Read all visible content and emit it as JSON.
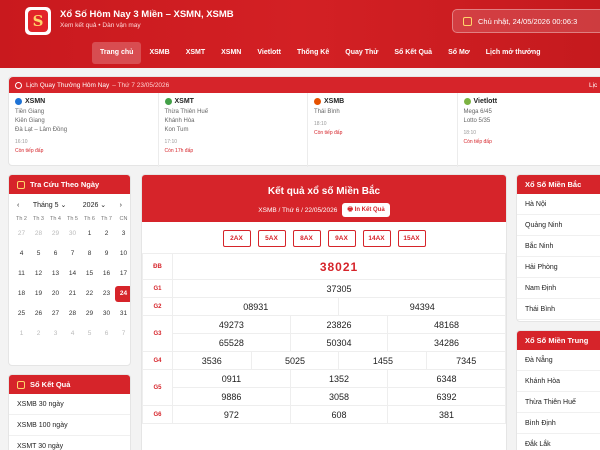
{
  "header": {
    "logo_letter": "S",
    "title": "Xổ Số Hôm Nay 3 Miền – XSMN, XSMB",
    "subtitle": "Xem kết quả • Dàn vận may",
    "date_text": "Chủ nhật, 24/05/2026 00:06:3"
  },
  "nav": [
    "Trang chủ",
    "XSMB",
    "XSMT",
    "XSMN",
    "Vietlott",
    "Thống Kê",
    "Quay Thử",
    "Sổ Kết Quả",
    "Sổ Mơ",
    "Lịch mở thưởng"
  ],
  "schedule": {
    "title": "Lịch Quay Thưởng Hôm Nay",
    "date": "– Thứ 7 23/05/2026",
    "right_label": "Lịc",
    "columns": [
      {
        "region": "XSMN",
        "color": "#1e73d6",
        "provinces": [
          "Tiền Giang",
          "Kiên Giang",
          "Đà Lạt – Lâm Đồng"
        ],
        "time": "16:10",
        "status": "Còn tiếp đấp"
      },
      {
        "region": "XSMT",
        "color": "#43a047",
        "provinces": [
          "Thừa Thiên Huế",
          "Khánh Hòa",
          "Kon Tum"
        ],
        "time": "17:10",
        "status": "Còn 17h đấp"
      },
      {
        "region": "XSMB",
        "color": "#e65100",
        "provinces": [
          "Thái Bình"
        ],
        "time": "18:10",
        "status": "Còn tiếp đấp"
      },
      {
        "region": "Vietlott",
        "color": "#7cb342",
        "provinces": [
          "Mega 6/45",
          "Lotto 5/35"
        ],
        "time": "18:10",
        "status": "Còn tiếp đấp"
      }
    ]
  },
  "calendar": {
    "title": "Tra Cứu Theo Ngày",
    "month": "Tháng 5",
    "year": "2026",
    "prev": "‹",
    "next": "›",
    "day_names": [
      "Th 2",
      "Th 3",
      "Th 4",
      "Th 5",
      "Th 6",
      "Th 7",
      "CN"
    ],
    "days": [
      {
        "d": "27",
        "m": true
      },
      {
        "d": "28",
        "m": true
      },
      {
        "d": "29",
        "m": true
      },
      {
        "d": "30",
        "m": true
      },
      {
        "d": "1"
      },
      {
        "d": "2"
      },
      {
        "d": "3"
      },
      {
        "d": "4"
      },
      {
        "d": "5"
      },
      {
        "d": "6"
      },
      {
        "d": "7"
      },
      {
        "d": "8"
      },
      {
        "d": "9"
      },
      {
        "d": "10"
      },
      {
        "d": "11"
      },
      {
        "d": "12"
      },
      {
        "d": "13"
      },
      {
        "d": "14"
      },
      {
        "d": "15"
      },
      {
        "d": "16"
      },
      {
        "d": "17"
      },
      {
        "d": "18"
      },
      {
        "d": "19"
      },
      {
        "d": "20"
      },
      {
        "d": "21"
      },
      {
        "d": "22"
      },
      {
        "d": "23"
      },
      {
        "d": "24",
        "t": true
      },
      {
        "d": "25"
      },
      {
        "d": "26"
      },
      {
        "d": "27"
      },
      {
        "d": "28"
      },
      {
        "d": "29"
      },
      {
        "d": "30"
      },
      {
        "d": "31"
      },
      {
        "d": "1",
        "m": true
      },
      {
        "d": "2",
        "m": true
      },
      {
        "d": "3",
        "m": true
      },
      {
        "d": "4",
        "m": true
      },
      {
        "d": "5",
        "m": true
      },
      {
        "d": "6",
        "m": true
      },
      {
        "d": "7",
        "m": true
      }
    ]
  },
  "books": {
    "title": "Sổ Kết Quả",
    "items": [
      "XSMB 30 ngày",
      "XSMB 100 ngày",
      "XSMT 30 ngày"
    ]
  },
  "results": {
    "title": "Kết quả xổ số Miền Bắc",
    "subtitle": "XSMB / Thứ 6 / 22/05/2026",
    "print_label": "In Kết Quả",
    "modes": [
      "2AX",
      "5AX",
      "8AX",
      "9AX",
      "14AX",
      "15AX"
    ],
    "rows": [
      {
        "label": "ĐB",
        "cells": [
          [
            "38021"
          ]
        ]
      },
      {
        "label": "G1",
        "cells": [
          [
            "37305"
          ]
        ]
      },
      {
        "label": "G2",
        "cells": [
          [
            "08931",
            "94394"
          ]
        ]
      },
      {
        "label": "G3",
        "cells": [
          [
            "49273",
            "23826",
            "48168"
          ],
          [
            "65528",
            "50304",
            "34286"
          ]
        ]
      },
      {
        "label": "G4",
        "cells": [
          [
            "3536",
            "5025",
            "1455",
            "7345"
          ]
        ]
      },
      {
        "label": "G5",
        "cells": [
          [
            "0911",
            "1352",
            "6348"
          ],
          [
            "9886",
            "3058",
            "6392"
          ]
        ]
      },
      {
        "label": "G6",
        "cells": [
          [
            "972",
            "608",
            "381"
          ]
        ]
      }
    ]
  },
  "north_panel": {
    "title": "Xổ Số Miền Bắc",
    "items": [
      "Hà Nội",
      "Quảng Ninh",
      "Bắc Ninh",
      "Hải Phòng",
      "Nam Định",
      "Thái Bình"
    ]
  },
  "central_panel": {
    "title": "Xổ Số Miền Trung",
    "items": [
      "Đà Nẵng",
      "Khánh Hòa",
      "Thừa Thiên Huế",
      "Bình Định",
      "Đắk Lắk"
    ]
  }
}
